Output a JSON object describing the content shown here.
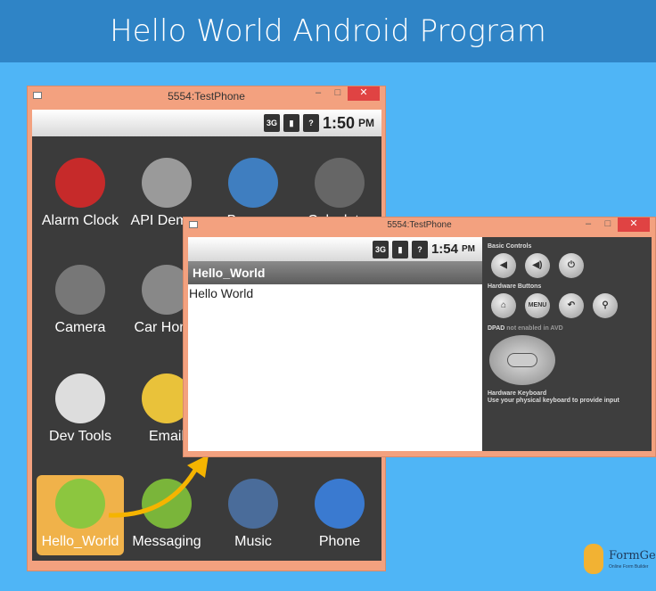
{
  "header": {
    "title": "Hello World Android Program"
  },
  "window1": {
    "title": "5554:TestPhone",
    "time": "1:50",
    "ampm": "PM",
    "apps": [
      {
        "label": "Alarm Clock",
        "color": "#c62a2a"
      },
      {
        "label": "API Demos",
        "color": "#9a9a9a"
      },
      {
        "label": "Browser",
        "color": "#3f7ec0"
      },
      {
        "label": "Calculator",
        "color": "#666"
      },
      {
        "label": "Camera",
        "color": "#777"
      },
      {
        "label": "Car Home",
        "color": "#888"
      },
      {
        "label": "",
        "color": ""
      },
      {
        "label": "",
        "color": ""
      },
      {
        "label": "Dev Tools",
        "color": "#ddd"
      },
      {
        "label": "Email",
        "color": "#e9c23a"
      },
      {
        "label": "",
        "color": ""
      },
      {
        "label": "",
        "color": ""
      },
      {
        "label": "Hello_World",
        "color": "#8cc63f"
      },
      {
        "label": "Messaging",
        "color": "#7ab53a"
      },
      {
        "label": "Music",
        "color": "#4a6c9a"
      },
      {
        "label": "Phone",
        "color": "#3a7ad0"
      }
    ]
  },
  "window2": {
    "title": "5554:TestPhone",
    "time": "1:54",
    "ampm": "PM",
    "app_title": "Hello_World",
    "content": "Hello World",
    "panel": {
      "basic": "Basic Controls",
      "hw": "Hardware Buttons",
      "menu": "MENU",
      "dpad": "DPAD",
      "dpad_note": "not enabled in AVD",
      "kb": "Hardware Keyboard",
      "kb_note": "Use your physical keyboard to provide input"
    }
  },
  "logo": {
    "name": "FormGet",
    "tagline": "Online Form Builder"
  }
}
